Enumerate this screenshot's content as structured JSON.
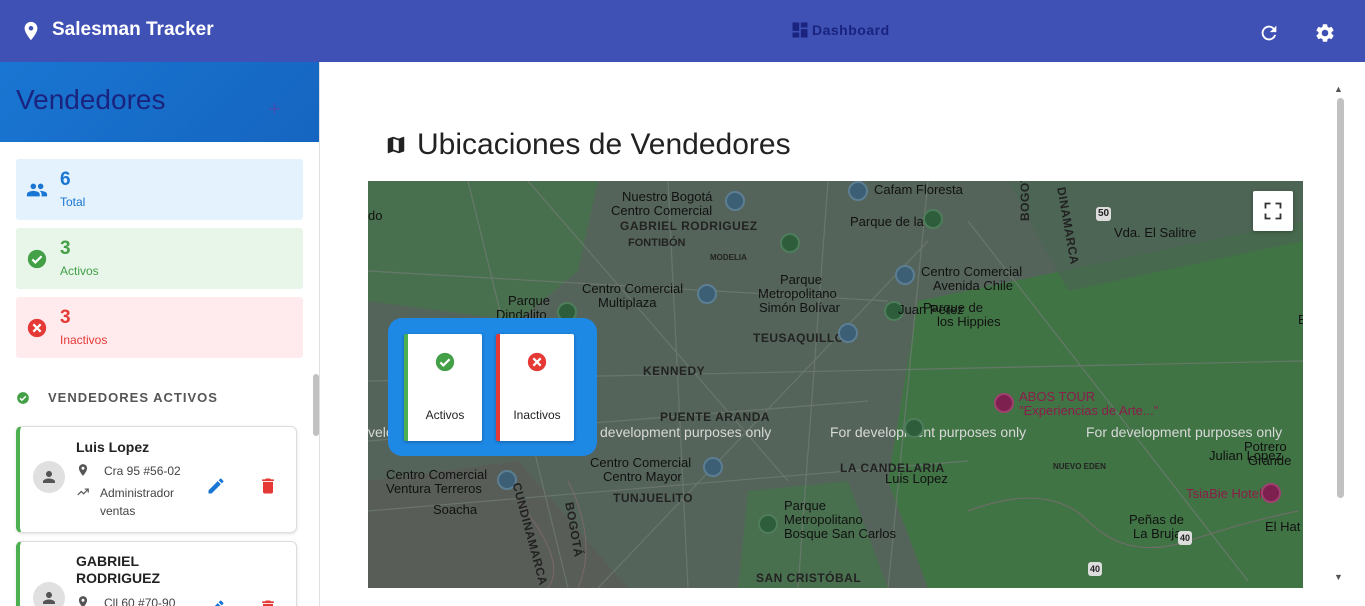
{
  "topbar": {
    "app_title": "Salesman Tracker",
    "dashboard_label": "Dashboard"
  },
  "sidebar": {
    "title": "Vendedores",
    "add_symbol": "+",
    "stats": {
      "total": {
        "value": "6",
        "label": "Total"
      },
      "active": {
        "value": "3",
        "label": "Activos"
      },
      "inactive": {
        "value": "3",
        "label": "Inactivos"
      }
    },
    "section_title": "VENDEDORES ACTIVOS",
    "vendors": [
      {
        "name": "Luis Lopez",
        "address": "Cra 95 #56-02",
        "role": "Administrador ventas"
      },
      {
        "name": "GABRIEL RODRIGUEZ",
        "address": "Cll 60 #70-90"
      }
    ]
  },
  "main": {
    "title": "Ubicaciones de Vendedores",
    "legend": {
      "active": "Activos",
      "inactive": "Inactivos"
    },
    "map_labels": {
      "nuestro_bogota": "Nuestro Bogotá",
      "centro_comercial_1": "Centro Comercial",
      "gabriel_rodriguez": "GABRIEL RODRIGUEZ",
      "fontibon": "FONTIBÓN",
      "modelia": "MODELIA",
      "cafam": "Cafam Floresta",
      "parque93": "Parque de la 93",
      "bogota_road": "BOGOTÁ",
      "cundinamarca_road": "DINAMARCA",
      "vda_salitre": "Vda. El Salitre",
      "cc_multiplaza_1": "Centro Comercial",
      "cc_multiplaza_2": "Multiplaza",
      "parque_simon_1": "Parque",
      "parque_simon_2": "Metropolitano",
      "parque_simon_3": "Simón Bolívar",
      "cc_andino_1": "Centro Comercial",
      "cc_andino_2": "Avenida Chile",
      "juan_perez": "Juan Perez",
      "parque_hippies_1": "Parque de",
      "parque_hippies_2": "los Hippies",
      "parque_dindalito_1": "Parque",
      "parque_dindalito_2": "Dindalito",
      "teusaquillo": "TEUSAQUILLO",
      "kennedy": "KENNEDY",
      "abos_tour_1": "ABOS TOUR",
      "abos_tour_2": "\"Experiencias de Arte...\"",
      "puente_aranda": "PUENTE ARANDA",
      "dev1": "development purposes only",
      "dev2": "For development purposes only",
      "dev3": "For development purposes only",
      "dev_partial": "velo",
      "potrero_1": "Potrero",
      "potrero_2": "Grande",
      "julian_lopez": "Julian Lopez",
      "cc_mayor_1": "Centro Comercial",
      "cc_mayor_2": "Centro Mayor",
      "cc_terreros_1": "Centro Comercial",
      "cc_terreros_2": "Ventura Terreros",
      "candelaria": "LA CANDELARIA",
      "luis_lopez": "Luis Lopez",
      "nuevo_eden": "NUEVO EDEN",
      "tsiabie": "TsiaBie Hotel",
      "tunjuelito": "TUNJUELITO",
      "soacha": "Soacha",
      "cundinamarca2": "CUNDINAMARCA",
      "bogota2": "BOGOTÁ",
      "parque_bosque_1": "Parque",
      "parque_bosque_2": "Metropolitano",
      "parque_bosque_3": "Bosque San Carlos",
      "penas_1": "Peñas de",
      "penas_2": "La Bruja",
      "el_hato": "El Hat",
      "san_cristobal": "SAN CRISTÓBAL",
      "do": "do",
      "road50": "50",
      "road40a": "40",
      "road40b": "40",
      "edge_e": "E"
    }
  },
  "colors": {
    "topbar": "#3f51b5",
    "active": "#4caf50",
    "inactive": "#e53935",
    "primary": "#1976d2"
  }
}
